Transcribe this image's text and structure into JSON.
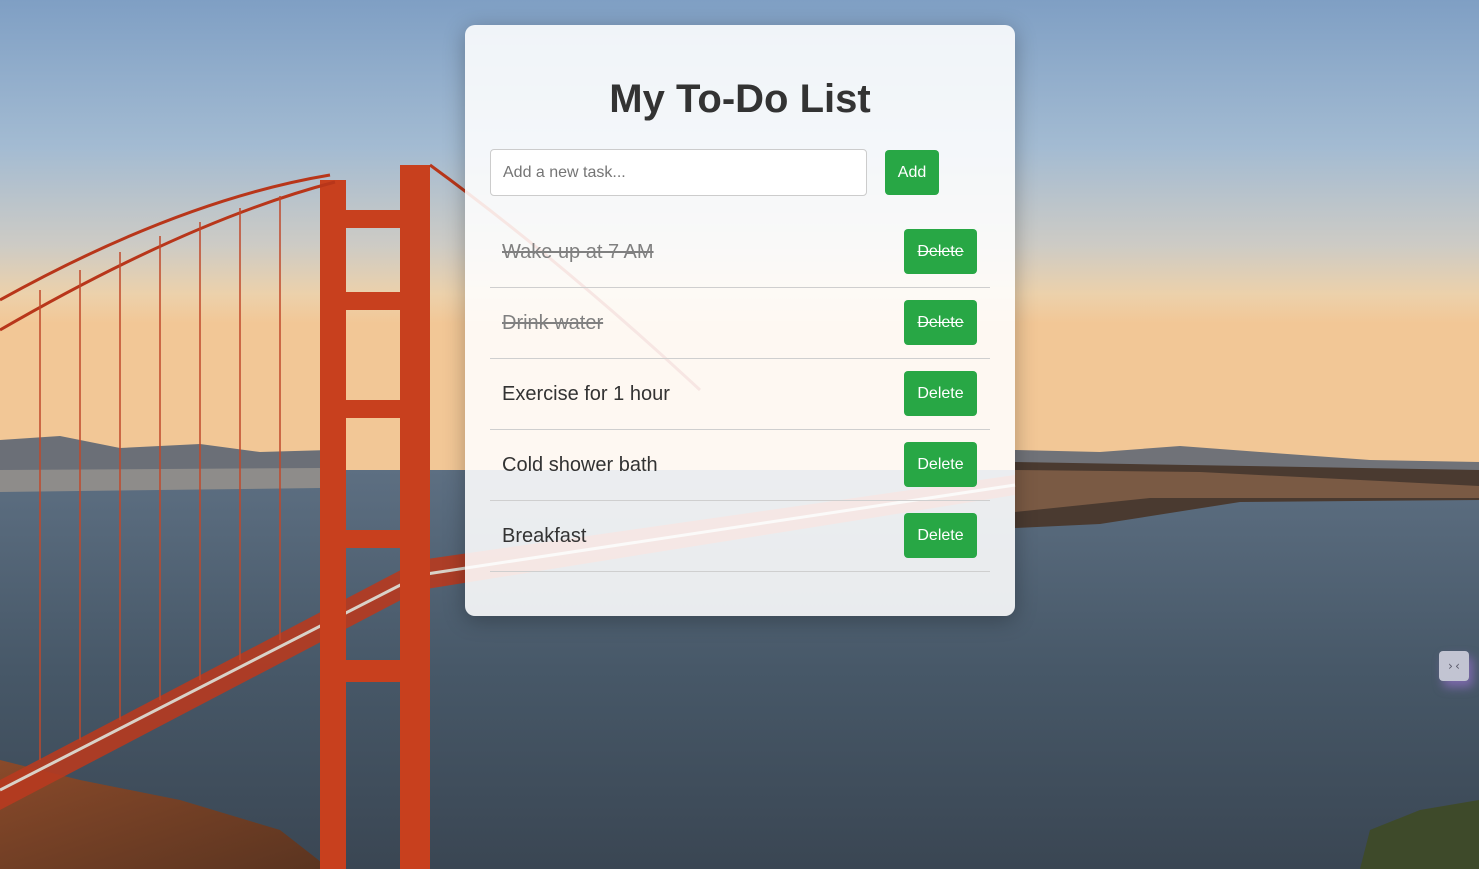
{
  "app": {
    "title": "My To-Do List"
  },
  "new_task": {
    "placeholder": "Add a new task...",
    "value": "",
    "add_label": "Add"
  },
  "tasks": [
    {
      "text": "Wake up at 7 AM",
      "completed": true,
      "delete_label": "Delete"
    },
    {
      "text": "Drink water",
      "completed": true,
      "delete_label": "Delete"
    },
    {
      "text": "Exercise for 1 hour",
      "completed": false,
      "delete_label": "Delete"
    },
    {
      "text": "Cold shower bath",
      "completed": false,
      "delete_label": "Delete"
    },
    {
      "text": "Breakfast",
      "completed": false,
      "delete_label": "Delete"
    }
  ],
  "theme": {
    "accent": "#28a745",
    "title_color": "#333333",
    "completed_text_color": "#808080"
  },
  "background": {
    "subject": "golden-gate-bridge-photo"
  },
  "side_widget": {
    "icon": "code-brackets-icon",
    "glyph": "›‹"
  }
}
